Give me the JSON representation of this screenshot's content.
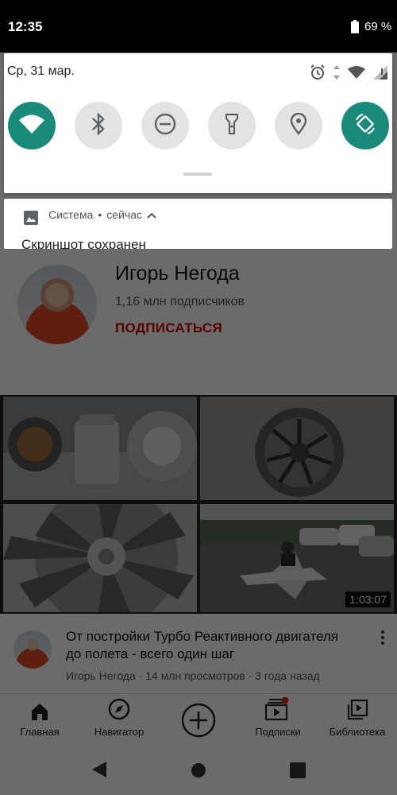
{
  "status_bar": {
    "time": "12:35",
    "battery_text": "69 %"
  },
  "quick_settings": {
    "date": "Ср, 31 мар.",
    "tiles": [
      {
        "name": "wifi",
        "state": "on"
      },
      {
        "name": "bluetooth",
        "state": "off"
      },
      {
        "name": "do-not-disturb",
        "state": "off"
      },
      {
        "name": "flashlight",
        "state": "off"
      },
      {
        "name": "location",
        "state": "off"
      },
      {
        "name": "auto-rotate",
        "state": "on"
      }
    ],
    "accent_color": "#1a8a7a"
  },
  "notification": {
    "app_name": "Система",
    "separator": "•",
    "when": "сейчас",
    "title": "Скриншот сохранен"
  },
  "channel": {
    "name": "Игорь Негода",
    "subscribers": "1,16 млн подписчиков",
    "subscribe_label": "ПОДПИСАТЬСЯ",
    "subscribe_color": "#cc0000"
  },
  "video": {
    "duration": "1:03:07",
    "title": "От постройки Турбо Реактивного двигателя до полета - всего один шаг",
    "meta": "Игорь Негода · 14 млн просмотров · 3 года назад"
  },
  "bottom_nav": {
    "items": [
      {
        "label": "Главная",
        "icon": "home-icon"
      },
      {
        "label": "Навигатор",
        "icon": "compass-icon"
      },
      {
        "label": "",
        "icon": "add-icon"
      },
      {
        "label": "Подписки",
        "icon": "subscriptions-icon"
      },
      {
        "label": "Библиотека",
        "icon": "library-icon"
      }
    ]
  },
  "system_nav": {
    "buttons": [
      "back-icon",
      "home-circle-icon",
      "recents-icon"
    ]
  }
}
